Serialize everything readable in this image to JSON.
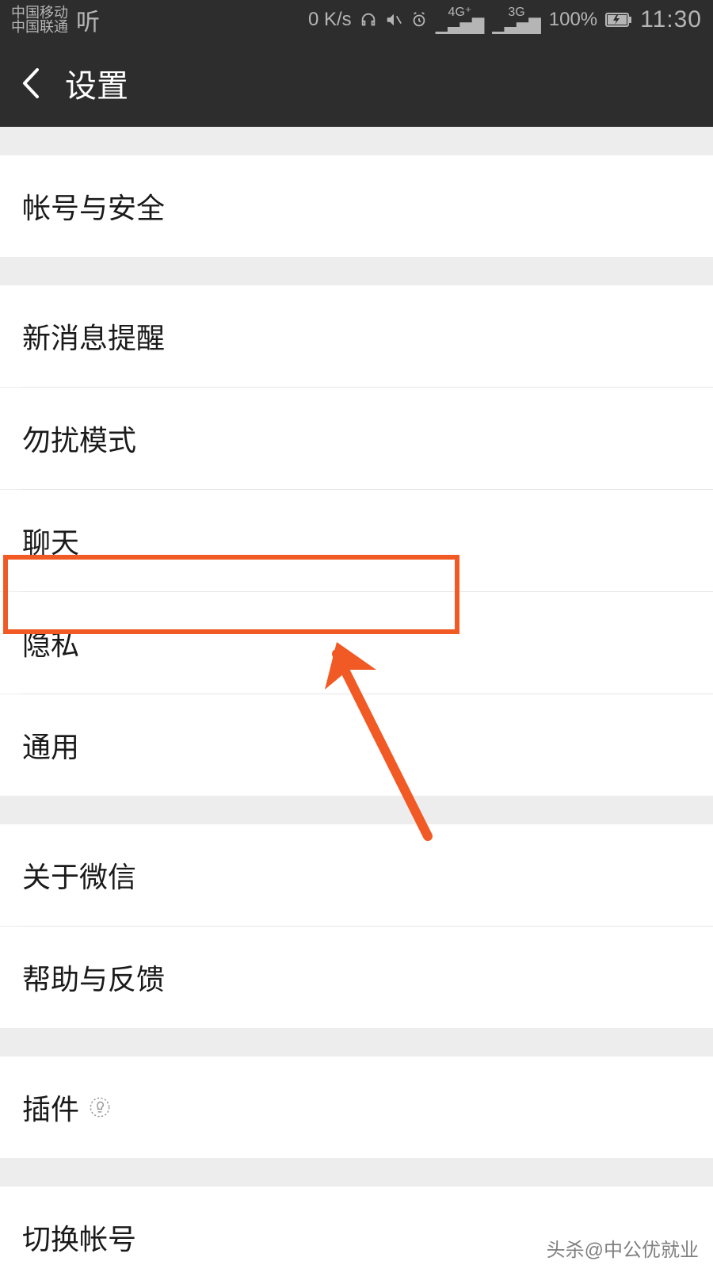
{
  "statusBar": {
    "carrier1": "中国移动",
    "carrier2": "中国联通",
    "tingIcon": "听",
    "speed": "0 K/s",
    "sig1": "4G⁺",
    "sig2": "3G",
    "battery": "100%",
    "time": "11:30"
  },
  "nav": {
    "title": "设置"
  },
  "groups": [
    {
      "items": [
        "帐号与安全"
      ]
    },
    {
      "items": [
        "新消息提醒",
        "勿扰模式",
        "聊天",
        "隐私",
        "通用"
      ]
    },
    {
      "items": [
        "关于微信",
        "帮助与反馈"
      ]
    },
    {
      "items": [
        "插件"
      ]
    },
    {
      "items": [
        "切换帐号"
      ]
    }
  ],
  "annotation": {
    "highlightedItem": "隐私",
    "highlightColor": "#f15a24"
  },
  "watermark": "头杀@中公优就业"
}
